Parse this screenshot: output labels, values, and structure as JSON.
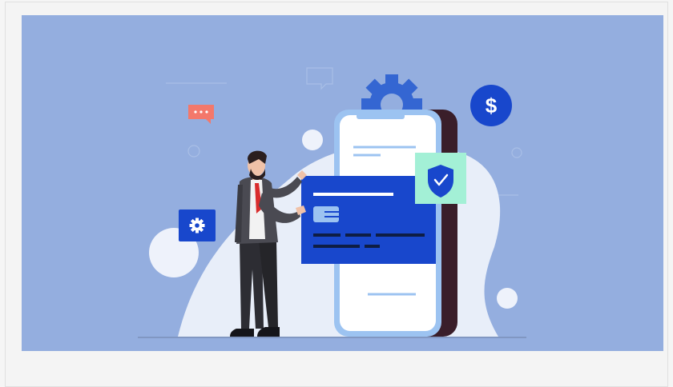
{
  "card": {
    "illustration": {
      "subject": "person-inserting-credit-card-into-phone",
      "background_color": "#94aedf",
      "accent_blue": "#1847cc",
      "accent_green": "#a3f0d6",
      "accent_salmon": "#f3786b",
      "icons": [
        "dollar-icon",
        "gear-icon",
        "shield-check-icon",
        "chat-bubble-icon",
        "settings-icon",
        "card-chip-icon"
      ]
    }
  }
}
